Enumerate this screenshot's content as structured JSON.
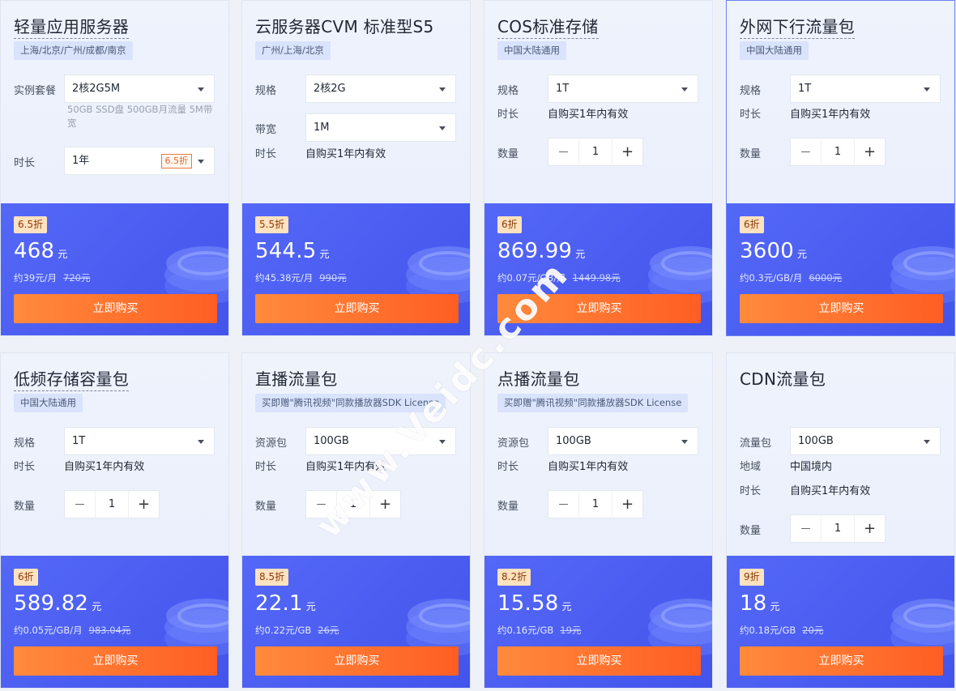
{
  "buy_label": "立即购买",
  "watermark": "www.Veidc.com",
  "colors": {
    "accent_blue": "#4a5cf0",
    "buy_orange": "#ff6a2a",
    "badge_bg": "#ffe2bf"
  },
  "cards": [
    {
      "title": "轻量应用服务器",
      "region": "上海/北京/广州/成都/南京",
      "rows": [
        {
          "type": "select",
          "label": "实例套餐",
          "value": "2核2G5M"
        },
        {
          "type": "note",
          "text": "50GB SSD盘 500GB月流量 5M带宽"
        },
        {
          "type": "select",
          "label": "时长",
          "value": "1年",
          "discount": "6.5折"
        }
      ],
      "badge": "6.5折",
      "price": "468",
      "unit": "元",
      "per": "约39元/月",
      "old": "720元"
    },
    {
      "title": "云服务器CVM 标准型S5",
      "region": "广州/上海/北京",
      "rows": [
        {
          "type": "select",
          "label": "规格",
          "value": "2核2G"
        },
        {
          "type": "select",
          "label": "带宽",
          "value": "1M"
        },
        {
          "type": "text",
          "label": "时长",
          "value": "自购买1年内有效"
        }
      ],
      "badge": "5.5折",
      "price": "544.5",
      "unit": "元",
      "per": "约45.38元/月",
      "old": "990元"
    },
    {
      "title": "COS标准存储",
      "region": "中国大陆通用",
      "rows": [
        {
          "type": "select",
          "label": "规格",
          "value": "1T"
        },
        {
          "type": "text",
          "label": "时长",
          "value": "自购买1年内有效"
        },
        {
          "type": "stepper",
          "label": "数量",
          "value": "1"
        }
      ],
      "badge": "6折",
      "price": "869.99",
      "unit": "元",
      "per": "约0.07元/GB/月",
      "old": "1449.98元"
    },
    {
      "title": "外网下行流量包",
      "region": "中国大陆通用",
      "rows": [
        {
          "type": "select",
          "label": "规格",
          "value": "1T"
        },
        {
          "type": "text",
          "label": "时长",
          "value": "自购买1年内有效"
        },
        {
          "type": "stepper",
          "label": "数量",
          "value": "1"
        }
      ],
      "badge": "6折",
      "price": "3600",
      "unit": "元",
      "per": "约0.3元/GB/月",
      "old": "6000元"
    },
    {
      "title": "低频存储容量包",
      "region": "中国大陆通用",
      "rows": [
        {
          "type": "select",
          "label": "规格",
          "value": "1T"
        },
        {
          "type": "text",
          "label": "时长",
          "value": "自购买1年内有效"
        },
        {
          "type": "stepper",
          "label": "数量",
          "value": "1"
        }
      ],
      "badge": "6折",
      "price": "589.82",
      "unit": "元",
      "per": "约0.05元/GB/月",
      "old": "983.04元"
    },
    {
      "title": "直播流量包",
      "region": "买即赠\"腾讯视频\"同款播放器SDK License",
      "rows": [
        {
          "type": "select",
          "label": "资源包",
          "value": "100GB"
        },
        {
          "type": "text",
          "label": "时长",
          "value": "自购买1年内有效"
        },
        {
          "type": "stepper",
          "label": "数量",
          "value": "1"
        }
      ],
      "badge": "8.5折",
      "price": "22.1",
      "unit": "元",
      "per": "约0.22元/GB",
      "old": "26元"
    },
    {
      "title": "点播流量包",
      "region": "买即赠\"腾讯视频\"同款播放器SDK License",
      "rows": [
        {
          "type": "select",
          "label": "资源包",
          "value": "100GB"
        },
        {
          "type": "text",
          "label": "时长",
          "value": "自购买1年内有效"
        },
        {
          "type": "stepper",
          "label": "数量",
          "value": "1"
        }
      ],
      "badge": "8.2折",
      "price": "15.58",
      "unit": "元",
      "per": "约0.16元/GB",
      "old": "19元"
    },
    {
      "title": "CDN流量包",
      "region": "",
      "rows": [
        {
          "type": "select",
          "label": "流量包",
          "value": "100GB"
        },
        {
          "type": "text",
          "label": "地域",
          "value": "中国境内"
        },
        {
          "type": "text",
          "label": "时长",
          "value": "自购买1年内有效"
        },
        {
          "type": "stepper",
          "label": "数量",
          "value": "1"
        }
      ],
      "badge": "9折",
      "price": "18",
      "unit": "元",
      "per": "约0.18元/GB",
      "old": "20元"
    }
  ]
}
